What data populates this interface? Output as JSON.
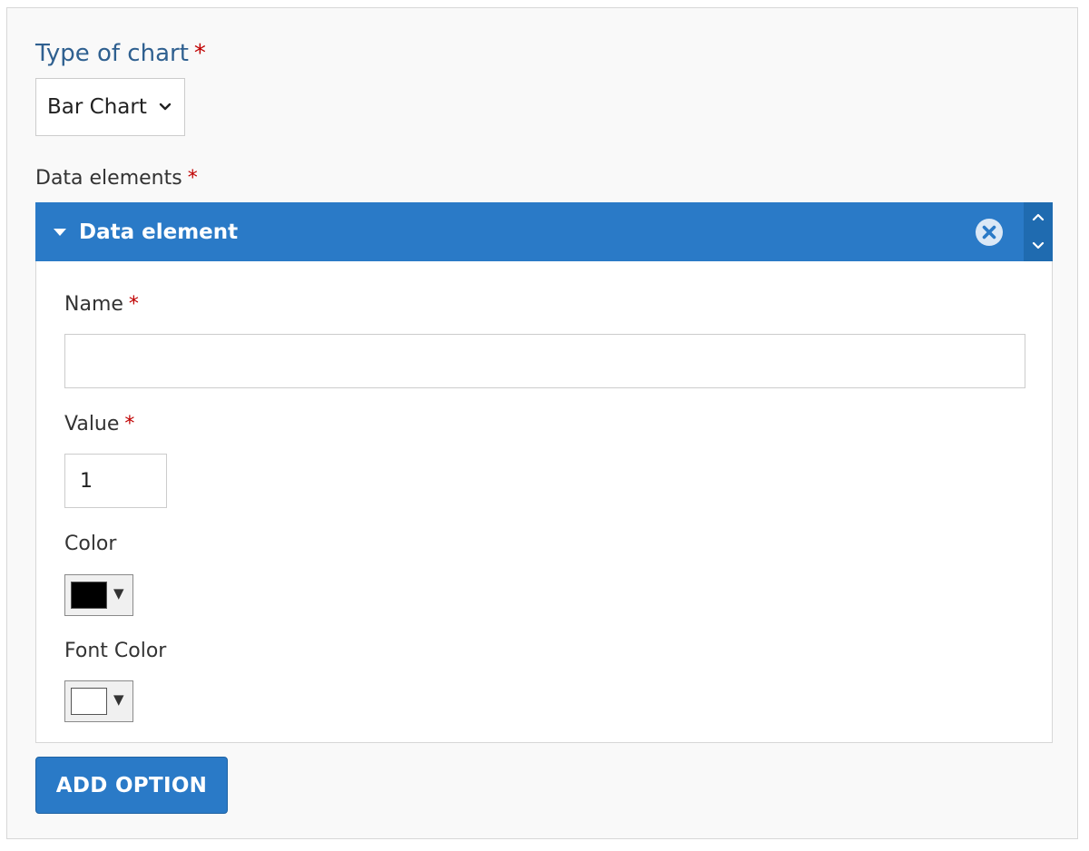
{
  "chart_type": {
    "label": "Type of chart",
    "required_mark": "*",
    "selected": "Bar Chart"
  },
  "data_elements": {
    "label": "Data elements",
    "required_mark": "*",
    "items": [
      {
        "title": "Data element",
        "fields": {
          "name": {
            "label": "Name",
            "required_mark": "*",
            "value": ""
          },
          "value": {
            "label": "Value",
            "required_mark": "*",
            "value": "1"
          },
          "color": {
            "label": "Color",
            "value": "#000000"
          },
          "font_color": {
            "label": "Font Color",
            "value": "#ffffff"
          }
        }
      }
    ]
  },
  "add_option_label": "ADD OPTION",
  "icons": {
    "dropdown": "chevron-down-icon",
    "collapse": "caret-down-icon",
    "remove": "close-circle-icon",
    "move_up": "chevron-up-icon",
    "move_down": "chevron-down-icon"
  },
  "colors": {
    "accent": "#2a7ac7",
    "heading": "#2f6090",
    "required": "#c00000"
  }
}
